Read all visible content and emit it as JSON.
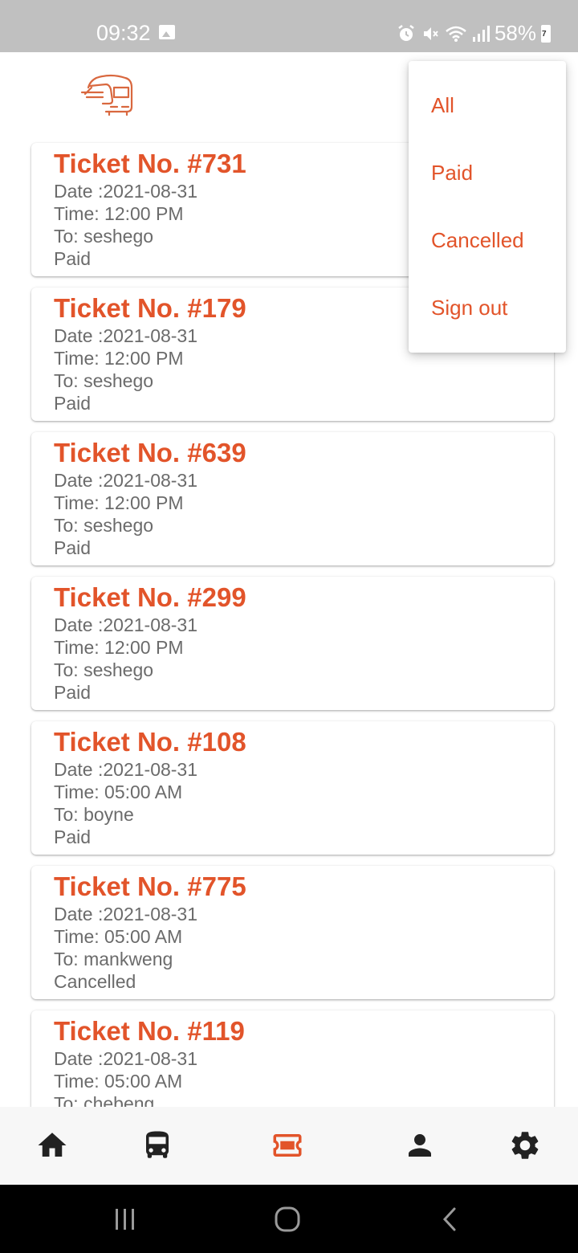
{
  "status_bar": {
    "time": "09:32",
    "battery": "58%",
    "battery_badge": "7",
    "icons": [
      "image-icon",
      "alarm-icon",
      "mute-icon",
      "wifi-icon",
      "signal-icon",
      "battery-icon"
    ]
  },
  "colors": {
    "accent": "#e2542a",
    "status_bar_bg": "#c0c0c0",
    "muted_text": "#6b6b6b",
    "nav_bg": "#f7f7f7",
    "nav_icon": "#222222"
  },
  "tickets": [
    {
      "title": "Ticket No. #731",
      "date": "Date :2021-08-31",
      "time": "Time: 12:00 PM",
      "to": "To: seshego",
      "status": "Paid"
    },
    {
      "title": "Ticket No. #179",
      "date": "Date :2021-08-31",
      "time": "Time: 12:00 PM",
      "to": "To: seshego",
      "status": "Paid"
    },
    {
      "title": "Ticket No. #639",
      "date": "Date :2021-08-31",
      "time": "Time: 12:00 PM",
      "to": "To: seshego",
      "status": "Paid"
    },
    {
      "title": "Ticket No. #299",
      "date": "Date :2021-08-31",
      "time": "Time: 12:00 PM",
      "to": "To: seshego",
      "status": "Paid"
    },
    {
      "title": "Ticket No. #108",
      "date": "Date :2021-08-31",
      "time": "Time: 05:00 AM",
      "to": "To: boyne",
      "status": "Paid"
    },
    {
      "title": "Ticket No. #775",
      "date": "Date :2021-08-31",
      "time": "Time: 05:00 AM",
      "to": "To: mankweng",
      "status": "Cancelled"
    },
    {
      "title": "Ticket No. #119",
      "date": "Date :2021-08-31",
      "time": "Time: 05:00 AM",
      "to": "To: chebeng",
      "status": ""
    }
  ],
  "filter_menu": {
    "items": [
      "All",
      "Paid",
      "Cancelled",
      "Sign out"
    ]
  },
  "bottom_nav": {
    "items": [
      "home-icon",
      "bus-icon",
      "ticket-icon",
      "person-icon",
      "settings-icon"
    ],
    "active": "ticket-icon"
  },
  "system_nav": {
    "items": [
      "recent-apps-icon",
      "home-circle-icon",
      "back-icon"
    ]
  }
}
